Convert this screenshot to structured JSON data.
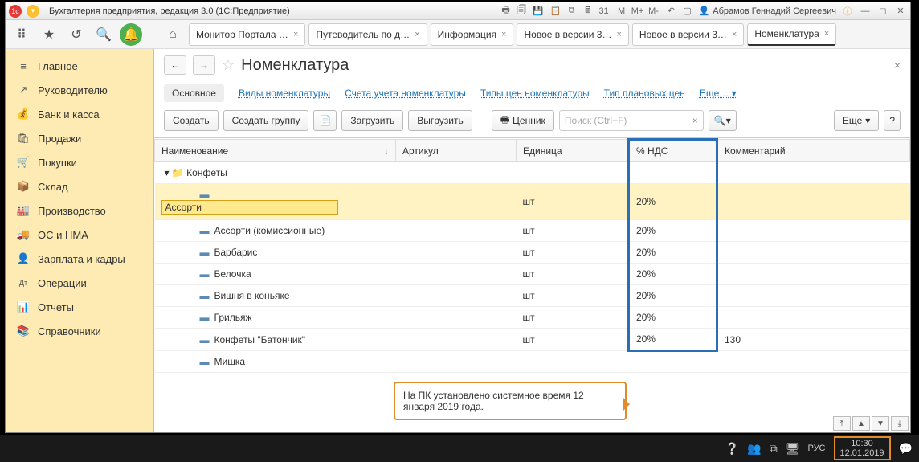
{
  "titlebar": {
    "app_title": "Бухгалтерия предприятия, редакция 3.0  (1С:Предприятие)",
    "user": "Абрамов Геннадий Сергеевич",
    "scale_buttons": [
      "M",
      "M+",
      "M-"
    ]
  },
  "tabs": [
    {
      "label": "Монитор Портала …",
      "active": false
    },
    {
      "label": "Путеводитель по д…",
      "active": false
    },
    {
      "label": "Информация",
      "active": false
    },
    {
      "label": "Новое в версии 3…",
      "active": false
    },
    {
      "label": "Новое в версии 3…",
      "active": false
    },
    {
      "label": "Номенклатура",
      "active": true
    }
  ],
  "sidebar": {
    "items": [
      {
        "icon": "≡",
        "label": "Главное"
      },
      {
        "icon": "↗",
        "label": "Руководителю"
      },
      {
        "icon": "💰",
        "label": "Банк и касса"
      },
      {
        "icon": "🛍",
        "label": "Продажи"
      },
      {
        "icon": "🛒",
        "label": "Покупки"
      },
      {
        "icon": "📦",
        "label": "Склад"
      },
      {
        "icon": "🏭",
        "label": "Производство"
      },
      {
        "icon": "🚚",
        "label": "ОС и НМА"
      },
      {
        "icon": "👤",
        "label": "Зарплата и кадры"
      },
      {
        "icon": "Дт",
        "label": "Операции"
      },
      {
        "icon": "📊",
        "label": "Отчеты"
      },
      {
        "icon": "📚",
        "label": "Справочники"
      }
    ]
  },
  "page": {
    "title": "Номенклатура",
    "subnav": {
      "current": "Основное",
      "links": [
        "Виды номенклатуры",
        "Счета учета номенклатуры",
        "Типы цен номенклатуры",
        "Тип плановых цен"
      ],
      "more": "Еще…"
    },
    "actions": {
      "create": "Создать",
      "create_group": "Создать группу",
      "load": "Загрузить",
      "unload": "Выгрузить",
      "price": "Ценник",
      "search_placeholder": "Поиск (Ctrl+F)",
      "more": "Еще",
      "help": "?"
    },
    "columns": {
      "name": "Наименование",
      "article": "Артикул",
      "unit": "Единица",
      "vat": "% НДС",
      "comment": "Комментарий"
    },
    "group": "Конфеты",
    "rows": [
      {
        "name": "Ассорти",
        "unit": "шт",
        "vat": "20%",
        "comment": "",
        "selected": true
      },
      {
        "name": "Ассорти (комиссионные)",
        "unit": "шт",
        "vat": "20%",
        "comment": ""
      },
      {
        "name": "Барбарис",
        "unit": "шт",
        "vat": "20%",
        "comment": ""
      },
      {
        "name": "Белочка",
        "unit": "шт",
        "vat": "20%",
        "comment": ""
      },
      {
        "name": "Вишня в коньяке",
        "unit": "шт",
        "vat": "20%",
        "comment": ""
      },
      {
        "name": "Грильяж",
        "unit": "шт",
        "vat": "20%",
        "comment": ""
      },
      {
        "name": "Конфеты \"Батончик\"",
        "unit": "шт",
        "vat": "20%",
        "comment": "130"
      },
      {
        "name": "Мишка",
        "unit": "",
        "vat": "",
        "comment": ""
      }
    ]
  },
  "callout": {
    "text": "На ПК установлено системное время 12 января  2019 года."
  },
  "taskbar": {
    "lang": "РУС",
    "time": "10:30",
    "date": "12.01.2019"
  }
}
